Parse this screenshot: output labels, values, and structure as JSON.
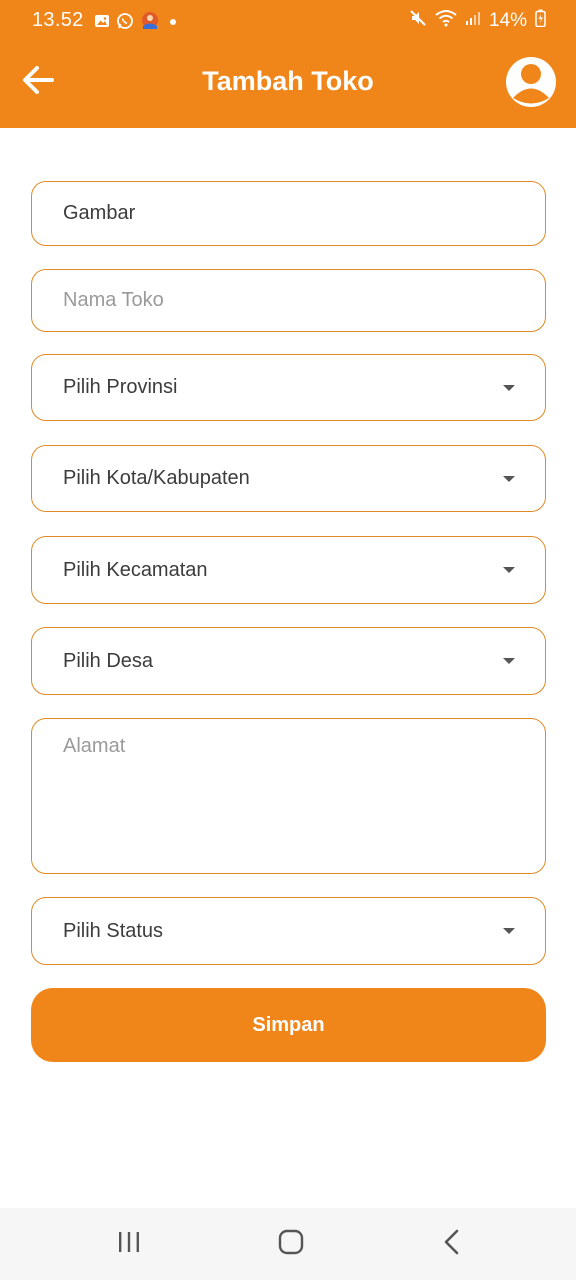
{
  "status_bar": {
    "time": "13.52",
    "battery": "14%",
    "icons": [
      "gallery-icon",
      "whatsapp-icon",
      "app-notification-icon",
      "dot-icon",
      "mute-icon",
      "wifi-icon",
      "signal-icon",
      "battery-icon"
    ]
  },
  "app_bar": {
    "title": "Tambah Toko",
    "back_icon": "arrow-left-icon",
    "profile_icon": "user-avatar-icon"
  },
  "form": {
    "image_label": "Gambar",
    "store_name_placeholder": "Nama Toko",
    "province_select": "Pilih Provinsi",
    "city_select": "Pilih Kota/Kabupaten",
    "district_select": "Pilih Kecamatan",
    "village_select": "Pilih Desa",
    "address_placeholder": "Alamat",
    "status_select": "Pilih Status",
    "save_label": "Simpan"
  },
  "nav_bar": {
    "icons": [
      "recent-apps-icon",
      "home-icon",
      "back-icon"
    ]
  },
  "colors": {
    "accent": "#F0861A",
    "field_border": "#E08A26"
  }
}
